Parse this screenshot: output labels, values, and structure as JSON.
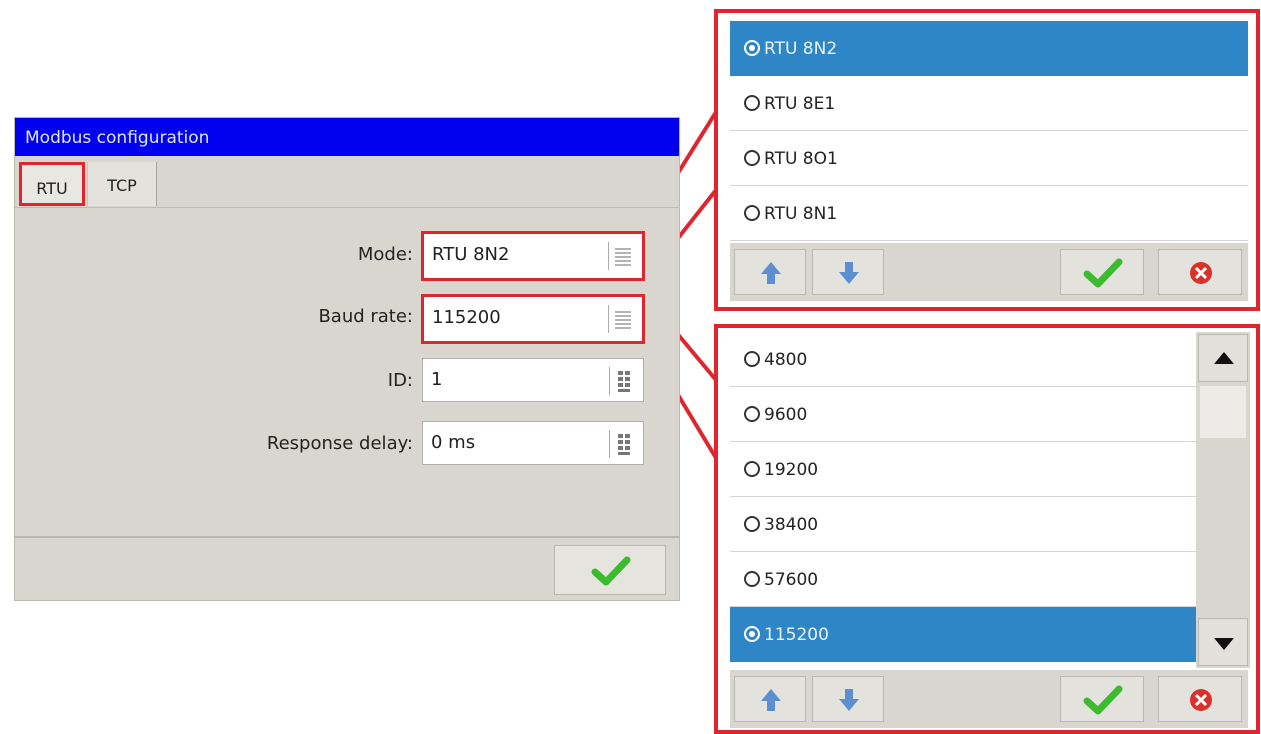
{
  "dialog": {
    "title": "Modbus configuration",
    "tabs": [
      {
        "label": "RTU",
        "active": true
      },
      {
        "label": "TCP",
        "active": false
      }
    ],
    "fields": {
      "mode": {
        "label": "Mode:",
        "value": "RTU 8N2",
        "icon": "list-icon"
      },
      "baud_rate": {
        "label": "Baud rate:",
        "value": "115200",
        "icon": "list-icon"
      },
      "id": {
        "label": "ID:",
        "value": "1",
        "icon": "keypad-icon"
      },
      "response_delay": {
        "label": "Response delay:",
        "value": "0 ms",
        "icon": "keypad-icon"
      }
    },
    "ok_icon": "check-icon"
  },
  "mode_popup": {
    "options": [
      {
        "label": "RTU 8N2",
        "selected": true
      },
      {
        "label": "RTU 8E1",
        "selected": false
      },
      {
        "label": "RTU 8O1",
        "selected": false
      },
      {
        "label": "RTU 8N1",
        "selected": false
      }
    ],
    "buttons": [
      "arrow-up-icon",
      "arrow-down-icon",
      "check-icon",
      "cancel-icon"
    ]
  },
  "baud_popup": {
    "options": [
      {
        "label": "4800",
        "selected": false
      },
      {
        "label": "9600",
        "selected": false
      },
      {
        "label": "19200",
        "selected": false
      },
      {
        "label": "38400",
        "selected": false
      },
      {
        "label": "57600",
        "selected": false
      },
      {
        "label": "115200",
        "selected": true
      }
    ],
    "buttons": [
      "arrow-up-icon",
      "arrow-down-icon",
      "check-icon",
      "cancel-icon"
    ],
    "scrollbar": [
      "scroll-up-icon",
      "scroll-down-icon"
    ]
  },
  "colors": {
    "title_bar": "#0000ee",
    "highlight": "#e0252f",
    "selection": "#2f86c6",
    "panel": "#d9d6cf",
    "check": "#3dbb2f"
  }
}
